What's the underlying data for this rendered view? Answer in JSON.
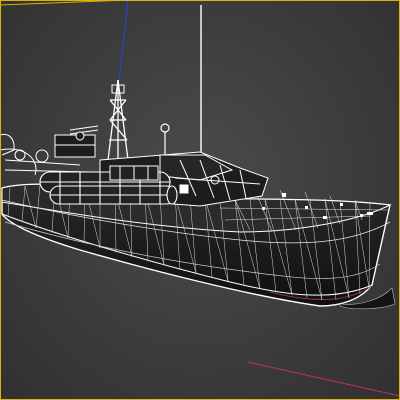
{
  "viewport": {
    "mode": "wireframe",
    "object": "patrol-boat-model",
    "background": "#3e3e3e",
    "active_border_color": "#e0b010",
    "wire_color": "#ffffff",
    "hull_fill": "#1a1a1c"
  },
  "axes": {
    "x_color": "#c0306a",
    "y_color": "#d4b400",
    "z_color": "#2f40c8"
  }
}
